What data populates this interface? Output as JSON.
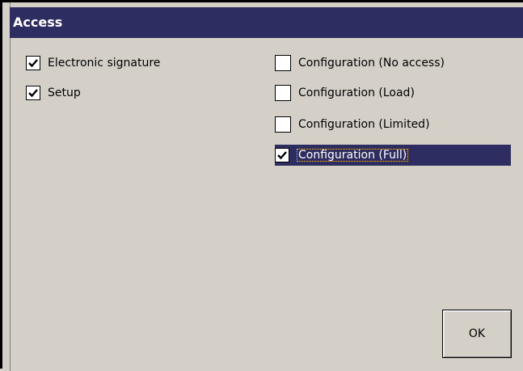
{
  "window": {
    "title": "Access"
  },
  "left_options": [
    {
      "label": "Electronic signature",
      "checked": true
    },
    {
      "label": "Setup",
      "checked": true
    }
  ],
  "right_options": [
    {
      "label": "Configuration (No access)",
      "checked": false
    },
    {
      "label": "Configuration (Load)",
      "checked": false
    },
    {
      "label": "Configuration (Limited)",
      "checked": false
    },
    {
      "label": "Configuration (Full)",
      "checked": true,
      "selected": true
    }
  ],
  "buttons": {
    "ok_label": "OK"
  },
  "colors": {
    "titlebar": "#2e2d61",
    "selection": "#2e2d61",
    "face": "#d4d0c8"
  }
}
